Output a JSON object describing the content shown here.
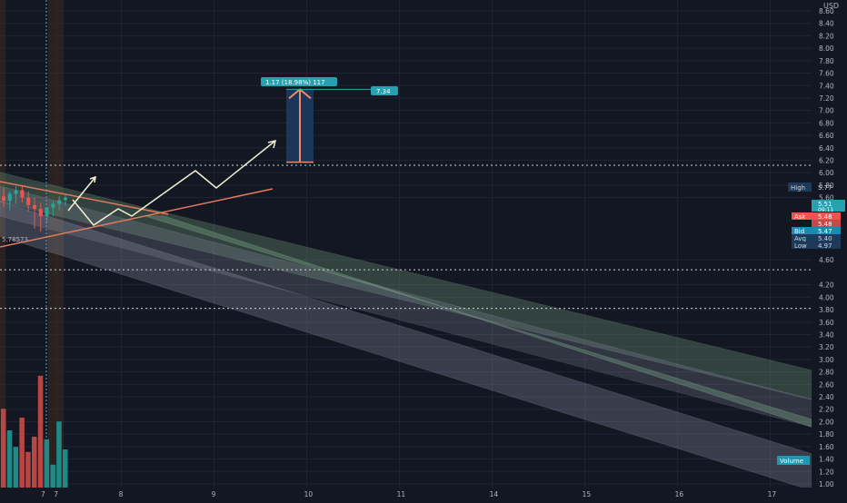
{
  "app": {
    "currency": "USD"
  },
  "colors": {
    "background": "#131722",
    "grid": "#1f2433",
    "candle_up": "#26a69a",
    "candle_down": "#ef5350",
    "trendline": "#e07a5f",
    "arrow": "#f2f0d0",
    "channel_green": "#7fb08a",
    "channel_grey": "#9aa0b4",
    "measure_fill": "#1d3a5f",
    "measure_label": "#26a1b0",
    "volume_label": "#2196b0"
  },
  "chart_data": {
    "type": "candlestick",
    "y_axis": {
      "ylim": [
        1.0,
        8.6
      ],
      "ticks": [
        "8.60",
        "8.40",
        "8.20",
        "8.00",
        "7.80",
        "7.60",
        "7.40",
        "7.20",
        "7.00",
        "6.80",
        "6.60",
        "6.40",
        "6.20",
        "6.00",
        "5.80",
        "5.60",
        "4.60",
        "4.20",
        "4.00",
        "3.80",
        "3.60",
        "3.40",
        "3.20",
        "3.00",
        "2.80",
        "2.60",
        "2.40",
        "2.20",
        "2.00",
        "1.80",
        "1.60",
        "1.40",
        "1.20",
        "1.00"
      ],
      "tick_values": [
        8.6,
        8.4,
        8.2,
        8.0,
        7.8,
        7.6,
        7.4,
        7.2,
        7.0,
        6.8,
        6.6,
        6.4,
        6.2,
        6.0,
        5.8,
        5.6,
        4.6,
        4.2,
        4.0,
        3.8,
        3.6,
        3.4,
        3.2,
        3.0,
        2.8,
        2.6,
        2.4,
        2.2,
        2.0,
        1.8,
        1.6,
        1.4,
        1.2,
        1.0
      ]
    },
    "x_axis": {
      "ticks": [
        "7",
        "7",
        "8",
        "9",
        "10",
        "11",
        "14",
        "15",
        "16",
        "17"
      ],
      "tick_values": [
        0.0,
        1.0,
        8.0,
        18.0,
        28.0,
        38.0,
        48.0,
        58.0,
        68.0,
        78.0
      ]
    },
    "candles": [
      {
        "x": 0,
        "o": 5.62,
        "h": 5.76,
        "c": 5.55,
        "l": 5.45
      },
      {
        "x": 1,
        "o": 5.55,
        "h": 5.7,
        "c": 5.66,
        "l": 5.4
      },
      {
        "x": 2,
        "o": 5.66,
        "h": 5.78,
        "c": 5.72,
        "l": 5.5
      },
      {
        "x": 3,
        "o": 5.72,
        "h": 5.8,
        "c": 5.6,
        "l": 5.52
      },
      {
        "x": 4,
        "o": 5.6,
        "h": 5.7,
        "c": 5.48,
        "l": 5.38
      },
      {
        "x": 5,
        "o": 5.48,
        "h": 5.6,
        "c": 5.42,
        "l": 5.1
      },
      {
        "x": 6,
        "o": 5.42,
        "h": 5.52,
        "c": 5.3,
        "l": 5.05
      },
      {
        "x": 7,
        "o": 5.3,
        "h": 5.45,
        "c": 5.44,
        "l": 5.2
      },
      {
        "x": 8,
        "o": 5.44,
        "h": 5.55,
        "c": 5.5,
        "l": 5.3
      },
      {
        "x": 9,
        "o": 5.5,
        "h": 5.62,
        "c": 5.56,
        "l": 5.4
      },
      {
        "x": 10,
        "o": 5.56,
        "h": 5.66,
        "c": 5.6,
        "l": 5.46
      }
    ],
    "volume": [
      0.62,
      0.45,
      0.32,
      0.55,
      0.28,
      0.4,
      0.88,
      0.38,
      0.18,
      0.52,
      0.3
    ],
    "price_levels": [
      {
        "value": 6.12,
        "label": "6.12"
      },
      {
        "value": 4.44,
        "label": "4.44"
      },
      {
        "value": 3.82,
        "label": "3.82"
      }
    ],
    "price_labels": {
      "high": {
        "name": "High",
        "value": "5.77"
      },
      "ask": {
        "name": "Ask",
        "value": "5.48"
      },
      "bid": {
        "name": "Bid",
        "value": "5.47"
      },
      "avg": {
        "name": "Avg",
        "value": "5.40"
      },
      "low": {
        "name": "Low",
        "value": "4.97"
      },
      "last_price": "5.51",
      "countdown": "09:11",
      "ask_sub": "5.48"
    },
    "measure_tool": {
      "label": "1.17 (18.98%) 117",
      "target_label": "7.34",
      "from": 6.17,
      "to": 7.34
    },
    "left_label": "5.78573",
    "volume_label": "Volume"
  }
}
